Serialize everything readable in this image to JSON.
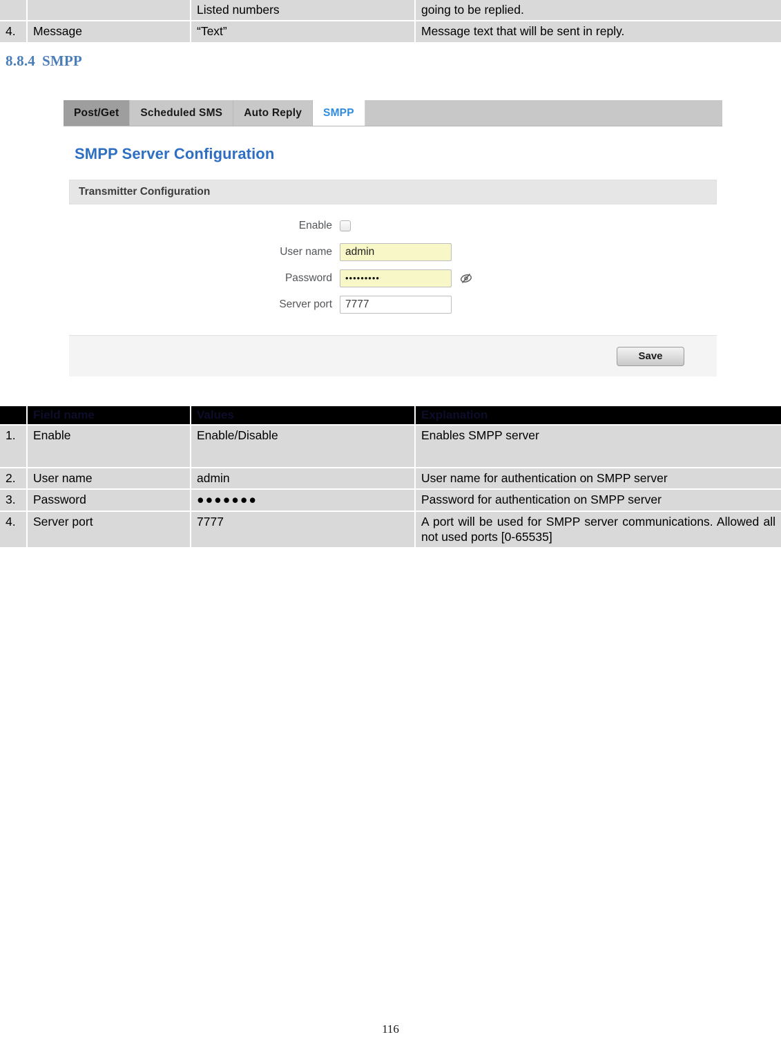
{
  "top_table": {
    "columns": [
      "",
      "",
      "",
      ""
    ],
    "rows": [
      {
        "num": "",
        "field": "",
        "value": "Listed numbers",
        "explanation": "going to be replied."
      },
      {
        "num": "4.",
        "field": "Message",
        "value": "“Text”",
        "explanation": "Message text that will be sent in reply."
      }
    ]
  },
  "heading": {
    "number": "8.8.4",
    "title": "SMPP"
  },
  "screenshot": {
    "tabs": [
      {
        "label": "Post/Get",
        "state": "hover"
      },
      {
        "label": "Scheduled SMS",
        "state": "normal"
      },
      {
        "label": "Auto Reply",
        "state": "normal"
      },
      {
        "label": "SMPP",
        "state": "active"
      }
    ],
    "panel_title": "SMPP Server Configuration",
    "section_title": "Transmitter Configuration",
    "fields": {
      "enable_label": "Enable",
      "enable_checked": false,
      "username_label": "User name",
      "username_value": "admin",
      "password_label": "Password",
      "password_value": "•••••••••",
      "serverport_label": "Server port",
      "serverport_value": "7777"
    },
    "save_label": "Save",
    "colors": {
      "active_tab_text": "#2e8ce0",
      "panel_title": "#2e6fc4",
      "autofill_field": "#f7f7c8"
    }
  },
  "spec_table": {
    "headers": [
      "",
      "Field name",
      "Values",
      "Explanation"
    ],
    "rows": [
      {
        "num": "1.",
        "field": "Enable",
        "value": "Enable/Disable",
        "explanation": "Enables SMPP server"
      },
      {
        "num": "2.",
        "field": "User name",
        "value": "admin",
        "explanation": "User name for authentication on SMPP server"
      },
      {
        "num": "3.",
        "field": "Password",
        "value": "●●●●●●●",
        "explanation": "Password for authentication on SMPP server"
      },
      {
        "num": "4.",
        "field": "Server port",
        "value": "7777",
        "explanation": "A port will be used for SMPP server communications. Allowed all not used ports [0-65535]"
      }
    ]
  },
  "page_number": "116"
}
